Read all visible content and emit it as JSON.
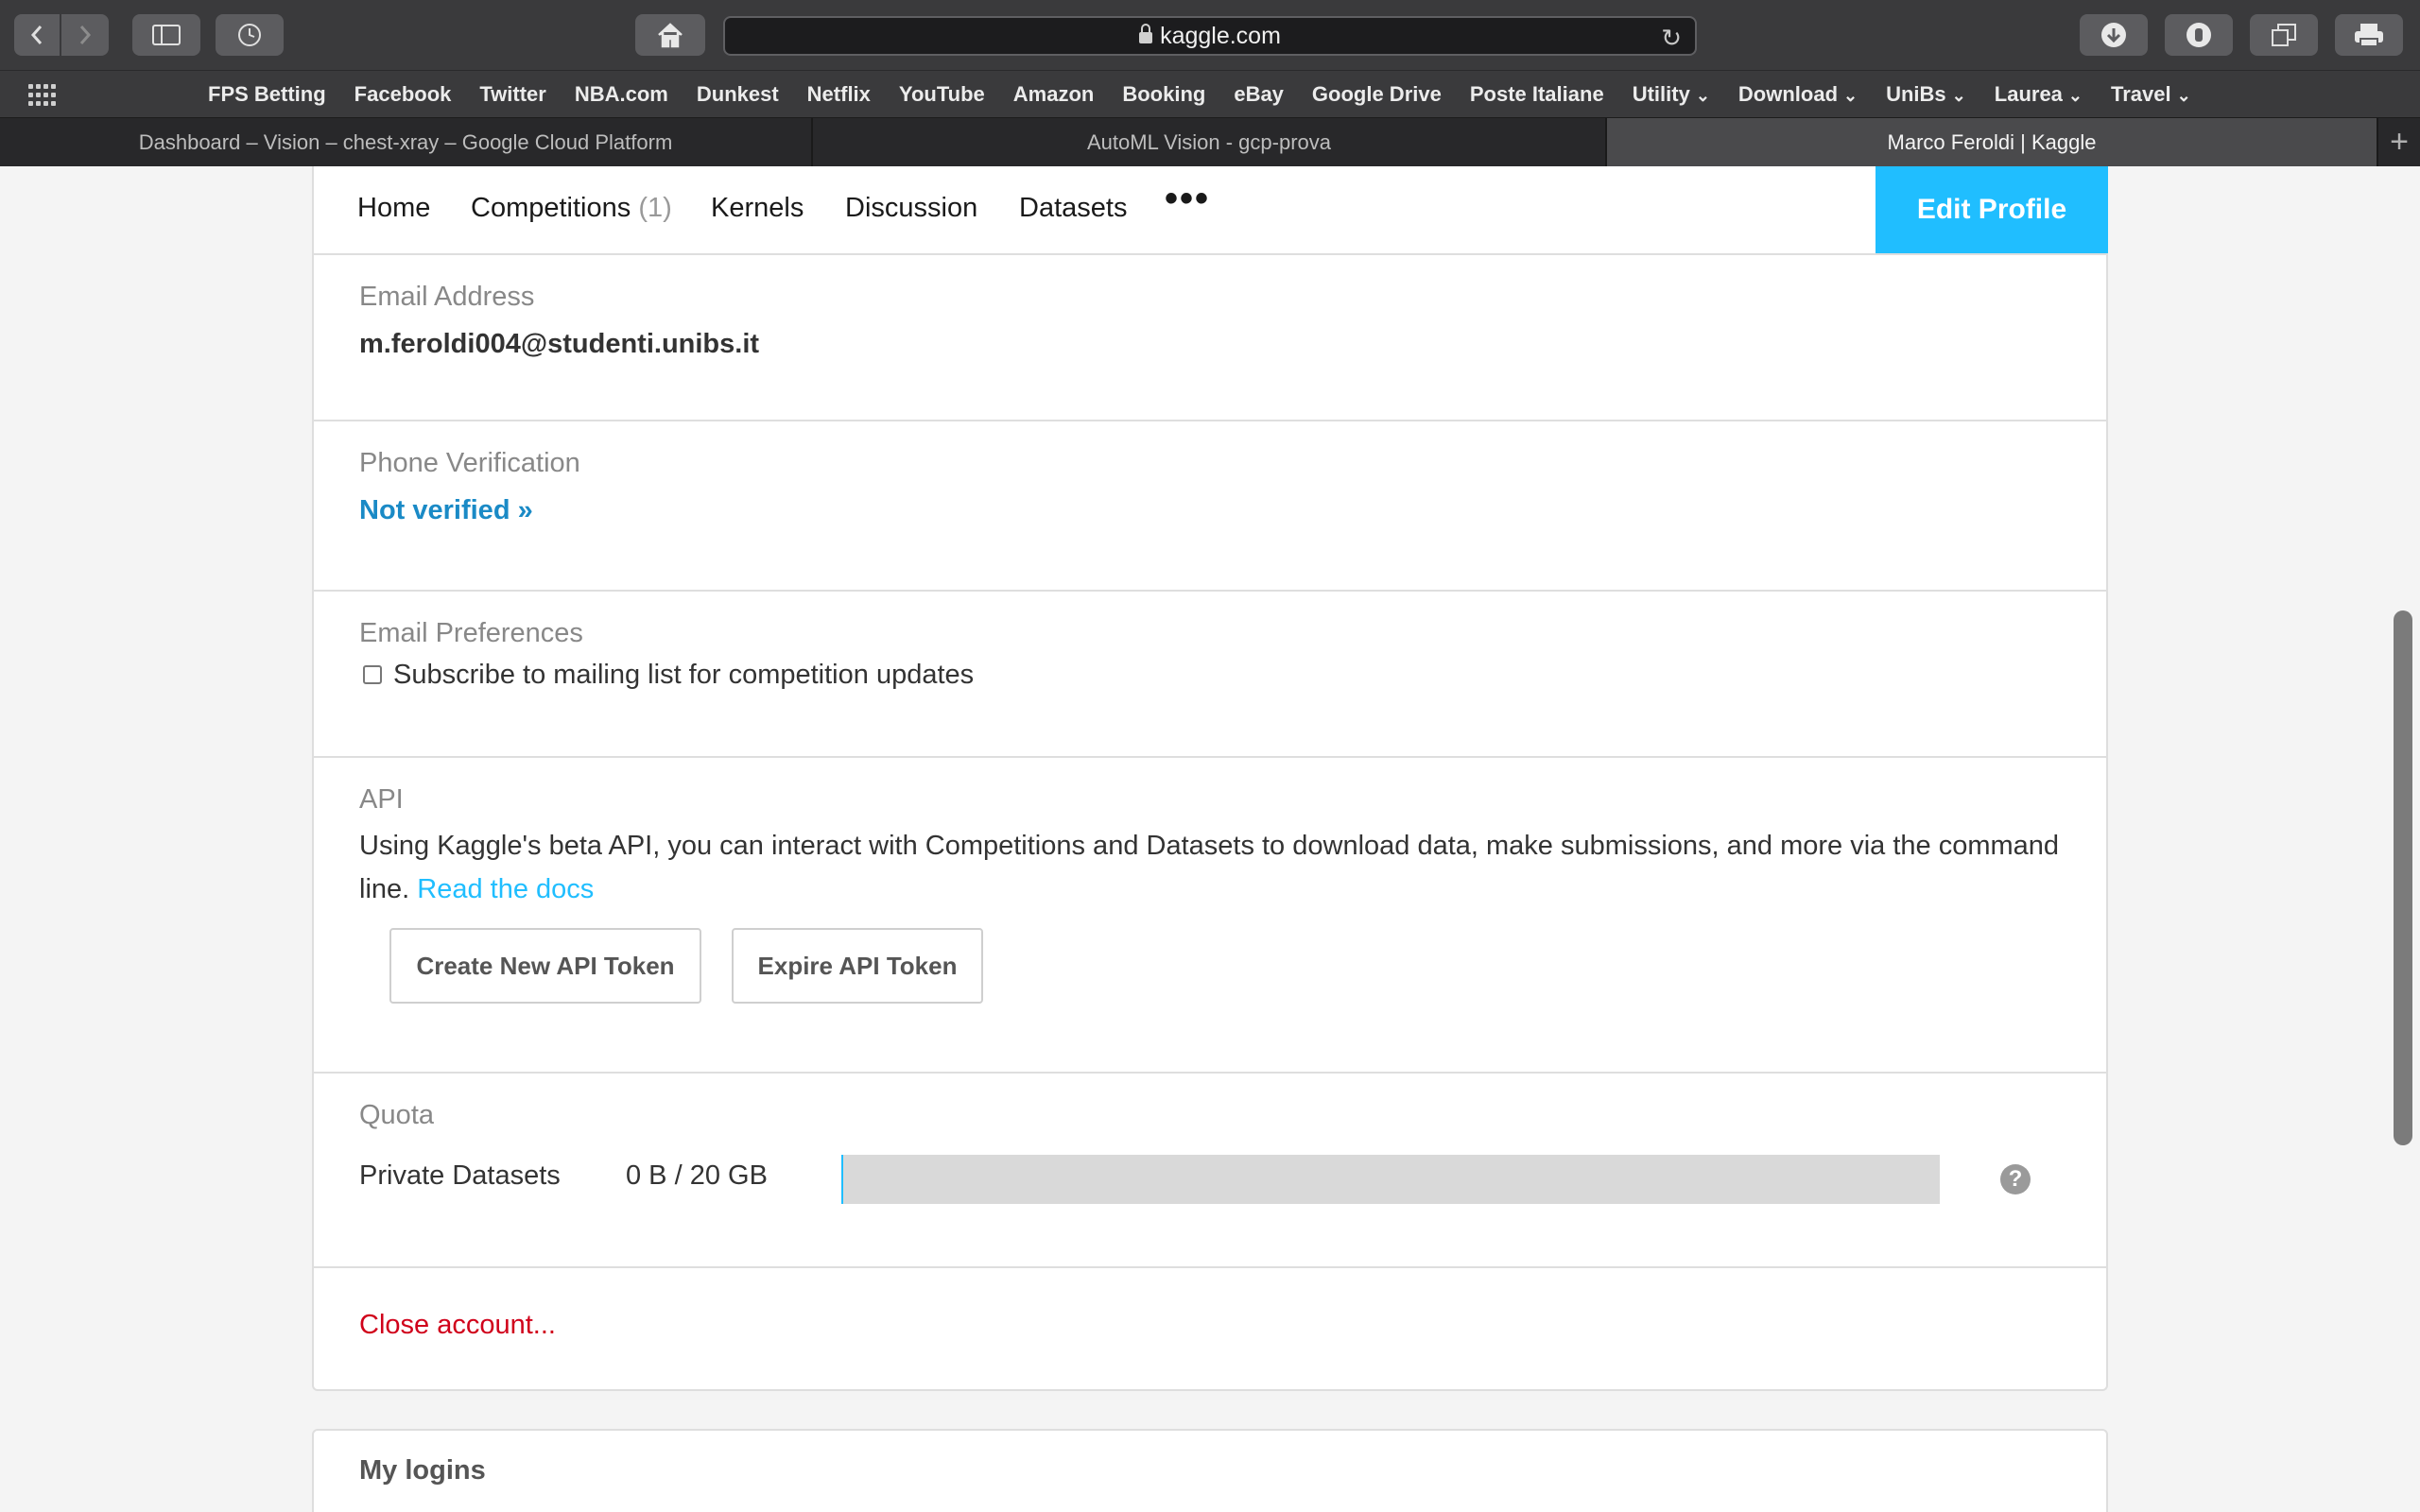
{
  "browser": {
    "url": "kaggle.com",
    "bookmarks": [
      "FPS Betting",
      "Facebook",
      "Twitter",
      "NBA.com",
      "Dunkest",
      "Netflix",
      "YouTube",
      "Amazon",
      "Booking",
      "eBay",
      "Google Drive",
      "Poste Italiane",
      "Utility",
      "Download",
      "UniBs",
      "Laurea",
      "Travel"
    ],
    "tabs": [
      {
        "title": "Dashboard – Vision – chest-xray – Google Cloud Platform"
      },
      {
        "title": "AutoML Vision - gcp-prova"
      },
      {
        "title": "Marco Feroldi | Kaggle"
      }
    ],
    "icons": {
      "back": "chevron-left-icon",
      "forward": "chevron-right-icon",
      "sidebar": "sidebar-icon",
      "history": "clock-icon",
      "home": "home-icon",
      "reload": "reload-icon",
      "download": "download-icon",
      "extension": "extension-icon",
      "tabs_overview": "tabs-overview-icon",
      "print": "print-icon",
      "new_tab": "plus-icon",
      "grid": "grid-icon"
    }
  },
  "nav": {
    "home": "Home",
    "competitions": "Competitions",
    "competitions_count": "(1)",
    "kernels": "Kernels",
    "discussion": "Discussion",
    "datasets": "Datasets",
    "more": "•••",
    "edit_profile": "Edit Profile"
  },
  "email": {
    "label": "Email Address",
    "value": "m.feroldi004@studenti.unibs.it"
  },
  "phone": {
    "label": "Phone Verification",
    "link": "Not verified »"
  },
  "email_prefs": {
    "label": "Email Preferences",
    "checkbox_label": "Subscribe to mailing list for competition updates",
    "checked": false
  },
  "api": {
    "label": "API",
    "text": "Using Kaggle's beta API, you can interact with Competitions and Datasets to download data, make submissions, and more via the command line.",
    "docs_link": "Read the docs",
    "create_button": "Create New API Token",
    "expire_button": "Expire API Token"
  },
  "quota": {
    "label": "Quota",
    "row_label": "Private Datasets",
    "usage": "0 B / 20 GB",
    "used_fraction": 0,
    "help": "?"
  },
  "close_account": "Close account...",
  "my_logins": "My logins",
  "colors": {
    "accent": "#20beff",
    "link_blue": "#1a8ac6",
    "danger": "#d0021b"
  }
}
